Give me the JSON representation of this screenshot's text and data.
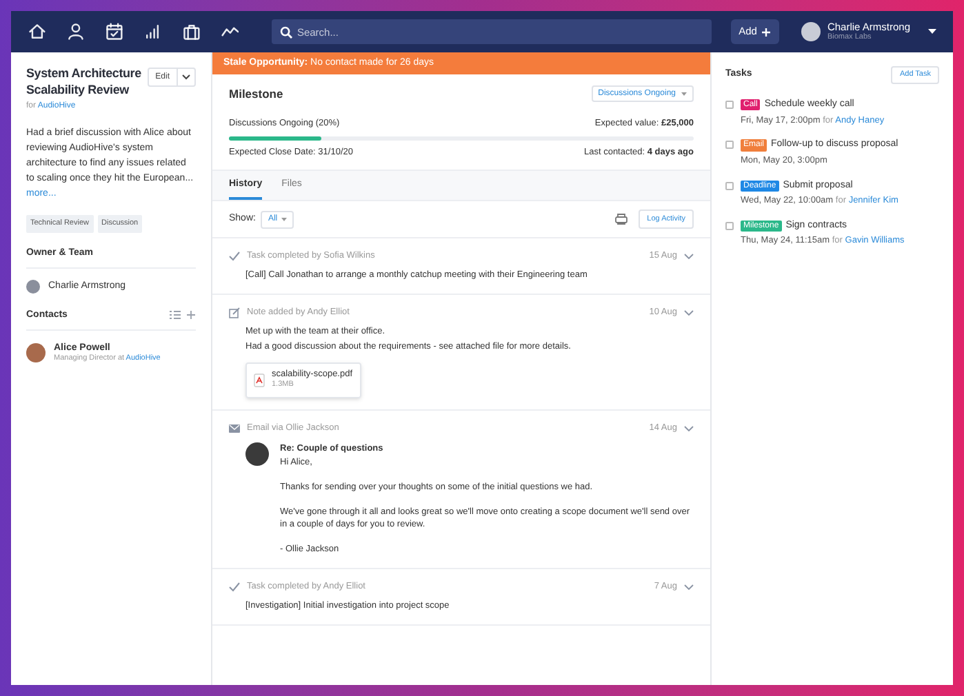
{
  "nav": {
    "search_placeholder": "Search...",
    "add_label": "Add",
    "user": {
      "name": "Charlie Armstrong",
      "company": "Biomax Labs"
    }
  },
  "opportunity": {
    "title": "System Architecture Scalability Review",
    "edit_label": "Edit",
    "for_prefix": "for",
    "for_link": "AudioHive",
    "description": "Had a brief discussion with Alice about reviewing AudioHive's system architecture to find any issues related to scaling once they hit the European...",
    "more_link": "more...",
    "tags": [
      "Technical Review",
      "Discussion"
    ],
    "owner_heading": "Owner & Team",
    "owner": "Charlie Armstrong",
    "contacts_heading": "Contacts",
    "contacts": [
      {
        "name": "Alice Powell",
        "role": "Managing Director at",
        "company": "AudioHive"
      }
    ]
  },
  "banner": {
    "bold": "Stale Opportunity:",
    "text": "No contact made for 26 days"
  },
  "milestone": {
    "heading": "Milestone",
    "stage": "Discussions Ongoing",
    "progress_label": "Discussions Ongoing (20%)",
    "level": 0.2,
    "expected_value_label": "Expected value:",
    "expected_value": "£25,000",
    "close_date": "Expected Close Date: 31/10/20",
    "last_contacted_label": "Last contacted:",
    "last_contacted": "4 days ago"
  },
  "tabs": [
    {
      "label": "History",
      "selected": true
    },
    {
      "label": "Files",
      "selected": false
    }
  ],
  "filter": {
    "label": "Show:",
    "value": "All",
    "log_button": "Log Activity"
  },
  "history": [
    {
      "kind": "task",
      "header": "Task completed by Sofia Wilkins",
      "date": "15 Aug",
      "lines": [
        "[Call] Call Jonathan to arrange a monthly catchup meeting with their Engineering team"
      ]
    },
    {
      "kind": "note",
      "header": "Note added by Andy Elliot",
      "date": "10 Aug",
      "lines": [
        "Met up with the team at their office.",
        "Had a good discussion about the requirements - see attached file for more details."
      ],
      "attachment": {
        "name": "scalability-scope.pdf",
        "size": "1.3MB"
      }
    },
    {
      "kind": "email",
      "header": "Email via Ollie Jackson",
      "date": "14 Aug",
      "subject": "Re: Couple of questions",
      "lines": [
        "Hi Alice,",
        "Thanks for sending over your thoughts on some of the initial questions we had.",
        "We've gone through it all and looks great so we'll move onto creating a scope document we'll send over in a couple of days for you to review.",
        "- Ollie Jackson"
      ]
    },
    {
      "kind": "task",
      "header": "Task completed by Andy Elliot",
      "date": "7 Aug",
      "lines": [
        "[Investigation] Initial investigation into project scope"
      ]
    }
  ],
  "tasks_panel": {
    "heading": "Tasks",
    "add_button": "Add Task",
    "tasks": [
      {
        "tag": "Call",
        "color": "#e0206e",
        "title": "Schedule weekly call",
        "when": "Fri, May 17, 2:00pm",
        "for_prefix": "for",
        "person": "Andy Haney",
        "checked": false
      },
      {
        "tag": "Email",
        "color": "#f07f3c",
        "title": "Follow-up to discuss proposal",
        "when": "Mon, May 20, 3:00pm",
        "checked": false
      },
      {
        "tag": "Deadline",
        "color": "#1e88e5",
        "title": "Submit proposal",
        "when": "Wed, May 22, 10:00am",
        "for_prefix": "for",
        "person": "Jennifer Kim",
        "checked": false
      },
      {
        "tag": "Milestone",
        "color": "#2bb88a",
        "title": "Sign contracts",
        "when": "Thu, May 24, 11:15am",
        "for_prefix": "for",
        "person": "Gavin Williams",
        "checked": false
      }
    ]
  }
}
